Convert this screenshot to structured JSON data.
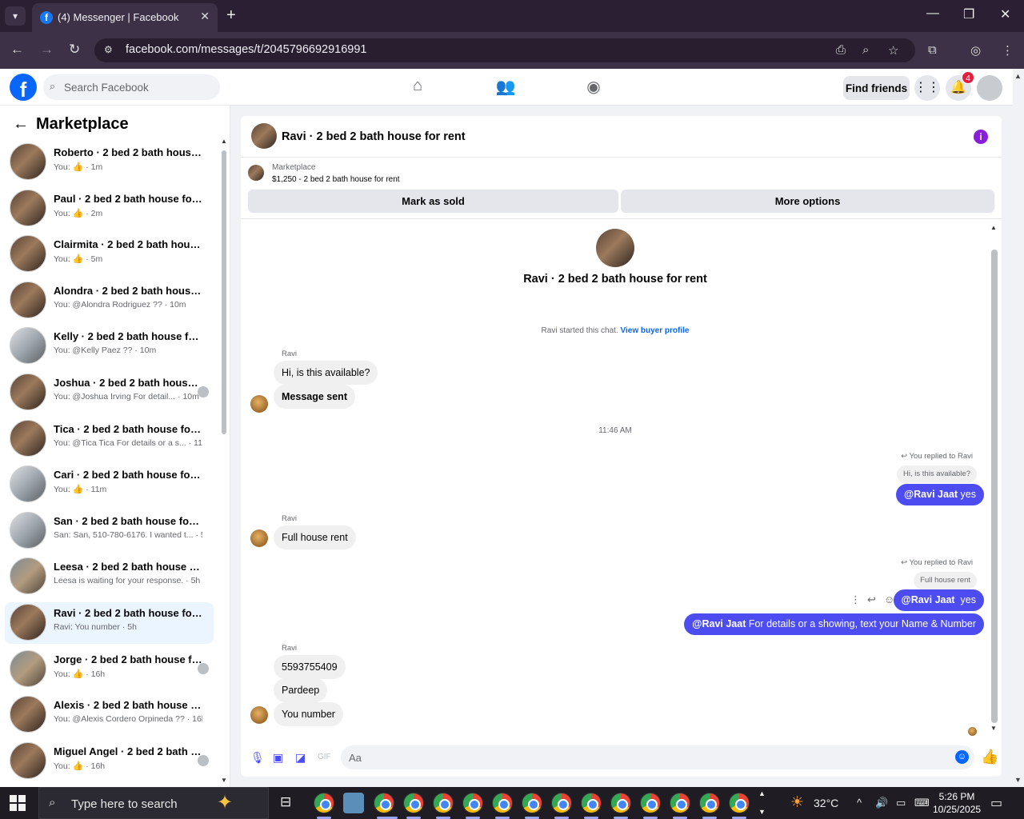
{
  "browser": {
    "tab_title": "(4) Messenger | Facebook",
    "url": "facebook.com/messages/t/2045796692916991"
  },
  "fb": {
    "search_placeholder": "Search Facebook",
    "find_friends": "Find friends",
    "notif_count": "4"
  },
  "sidebar": {
    "title": "Marketplace",
    "conversations": [
      {
        "name": "Roberto · 2 bed 2 bath house for rent",
        "prefix": "You: ",
        "like": true,
        "time": "1m"
      },
      {
        "name": "Paul · 2 bed 2 bath house for rent",
        "prefix": "You: ",
        "like": true,
        "time": "2m"
      },
      {
        "name": "Clairmita · 2 bed 2 bath house for rent",
        "prefix": "You: ",
        "like": true,
        "time": "5m"
      },
      {
        "name": "Alondra · 2 bed 2 bath house for rent",
        "prefix": "You: @Alondra Rodriguez ?? ",
        "like": false,
        "time": "10m"
      },
      {
        "name": "Kelly · 2 bed 2 bath house for rent",
        "prefix": "You: @Kelly Paez ?? ",
        "like": false,
        "time": "10m"
      },
      {
        "name": "Joshua · 2 bed 2 bath house for rent",
        "prefix": "You: @Joshua Irving For detail... ",
        "like": false,
        "time": "10m"
      },
      {
        "name": "Tica · 2 bed 2 bath house for rent",
        "prefix": "You: @Tica Tica For details or a s... ",
        "like": false,
        "time": "11m"
      },
      {
        "name": "Cari · 2 bed 2 bath house for rent",
        "prefix": "You: ",
        "like": true,
        "time": "11m"
      },
      {
        "name": "San · 2 bed 2 bath house for rent",
        "prefix": "San: San, 510-780-6176. I wanted t... ",
        "like": false,
        "time": "5h"
      },
      {
        "name": "Leesa · 2 bed 2 bath house for rent",
        "prefix": "Leesa is waiting for your response. ",
        "like": false,
        "time": "5h"
      },
      {
        "name": "Ravi · 2 bed 2 bath house for rent",
        "prefix": "Ravi: You number ",
        "like": false,
        "time": "5h"
      },
      {
        "name": "Jorge · 2 bed 2 bath house for rent",
        "prefix": "You: ",
        "like": true,
        "time": "16h"
      },
      {
        "name": "Alexis · 2 bed 2 bath house for rent",
        "prefix": "You: @Alexis Cordero Orpineda ?? ",
        "like": false,
        "time": "16h"
      },
      {
        "name": "Miguel Angel · 2 bed 2 bath house for rent",
        "prefix": "You: ",
        "like": true,
        "time": "16h"
      }
    ]
  },
  "chat": {
    "title": "Ravi · 2 bed 2 bath house for rent",
    "listing_category": "Marketplace",
    "listing_price": "$1,250 - 2 bed 2 bath house for rent",
    "mark_sold": "Mark as sold",
    "more_options": "More options",
    "intro_title": "Ravi · 2 bed 2 bath house for rent",
    "started_text": "Ravi started this chat.",
    "view_buyer": "View buyer profile",
    "sender": "Ravi",
    "msg1": "Hi, is this available?",
    "msg2": "Message sent",
    "time_sep": "11:46 AM",
    "replied_label": "You replied to Ravi",
    "quote1": "Hi, is this available?",
    "mention": "@Ravi Jaat",
    "out1_text": " yes",
    "msg3": "Full house rent",
    "quote2": "Full house rent",
    "out2_text": "  yes",
    "out3_text": " For details or a showing, text your Name & Number",
    "msg4": "5593755409",
    "msg5": "Pardeep",
    "msg6": "You number",
    "input_placeholder": "Aa"
  },
  "taskbar": {
    "search_text": "Type here to search",
    "temp": "32°C",
    "time": "5:26 PM",
    "date": "10/25/2025"
  }
}
